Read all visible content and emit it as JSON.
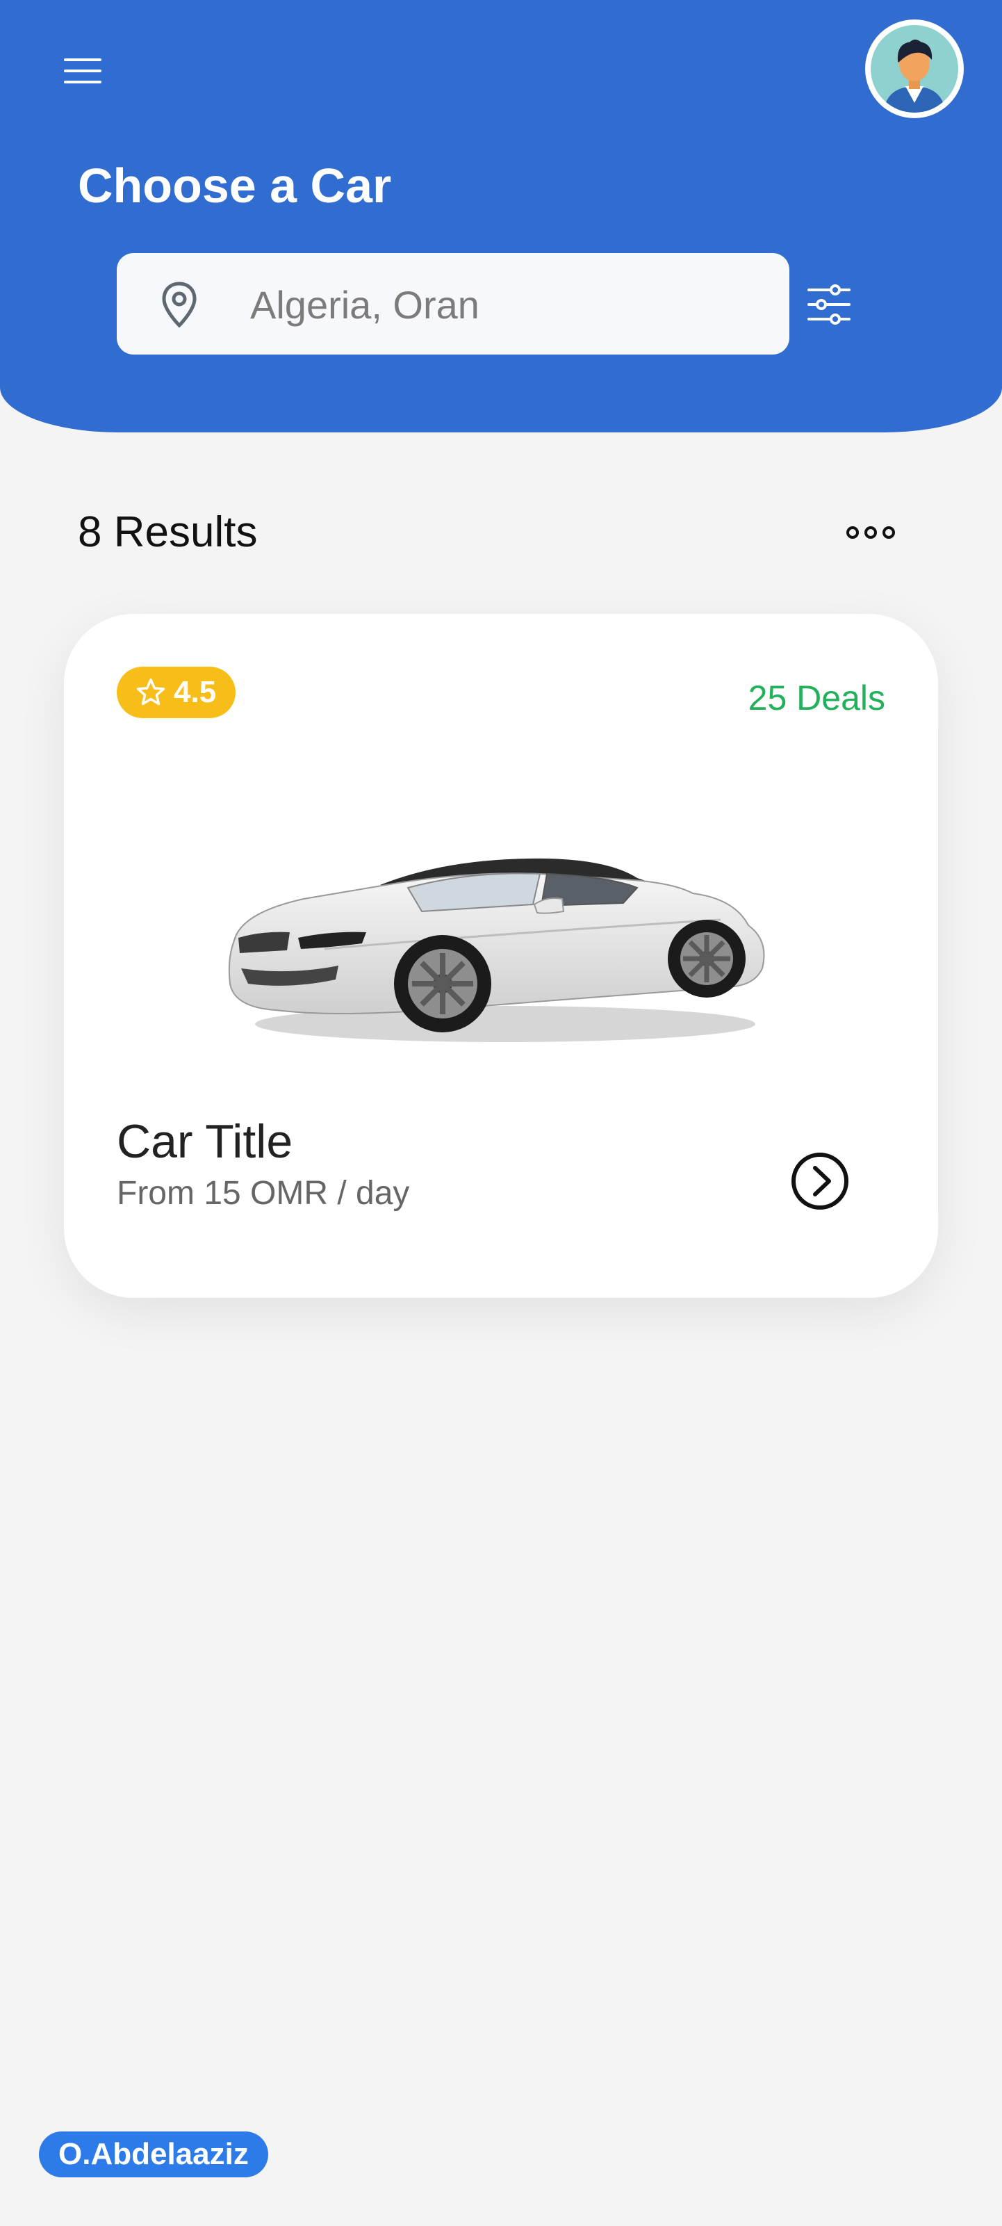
{
  "header": {
    "title": "Choose a Car",
    "menu_icon": "hamburger-menu-icon",
    "avatar_icon": "user-avatar"
  },
  "search": {
    "placeholder": "Algeria, Oran",
    "value": "",
    "location_icon": "map-pin-icon",
    "filter_icon": "sliders-icon"
  },
  "results": {
    "label": "8 Results",
    "more_icon": "more-horizontal-icon"
  },
  "car_card": {
    "rating": "4.5",
    "rating_icon": "star-icon",
    "deals": "25 Deals",
    "title": "Car Title",
    "price": "From 15 OMR / day",
    "arrow_icon": "chevron-right-circle-icon"
  },
  "footer": {
    "author": "O.Abdelaaziz"
  },
  "colors": {
    "primary": "#316dd1",
    "rating": "#f7bd19",
    "deals": "#22b15b",
    "author_badge": "#2d7be8",
    "background": "#f4f4f4"
  }
}
